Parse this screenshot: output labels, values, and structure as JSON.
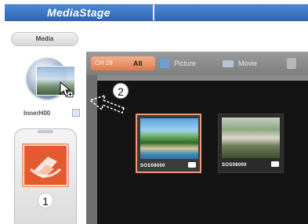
{
  "app": {
    "title": "MediaStage"
  },
  "sidebar": {
    "section_label": "Media",
    "device": {
      "name": "InnerH00",
      "icon": "device-disc-icon"
    },
    "card": {
      "icon": "media-card-icon"
    }
  },
  "tabs": {
    "all_count": "CH 28",
    "items": [
      {
        "label": "All",
        "icon": "all-icon",
        "selected": true
      },
      {
        "label": "Picture",
        "icon": "picture-icon",
        "selected": false
      },
      {
        "label": "Movie",
        "icon": "movie-icon",
        "selected": false
      },
      {
        "label": "",
        "icon": "music-icon",
        "selected": false
      }
    ]
  },
  "thumbnails": [
    {
      "label": "SOS08000",
      "selected": true,
      "badge_icon": "picture-badge-icon"
    },
    {
      "label": "SOS08000",
      "selected": false,
      "badge_icon": "picture-badge-icon"
    }
  ],
  "steps": {
    "first": "1",
    "second": "2"
  },
  "colors": {
    "title_bar": "#2f63b2",
    "accent": "#de7a4b",
    "panel_bg": "#141414",
    "panel_frame": "#8a8a8a"
  }
}
